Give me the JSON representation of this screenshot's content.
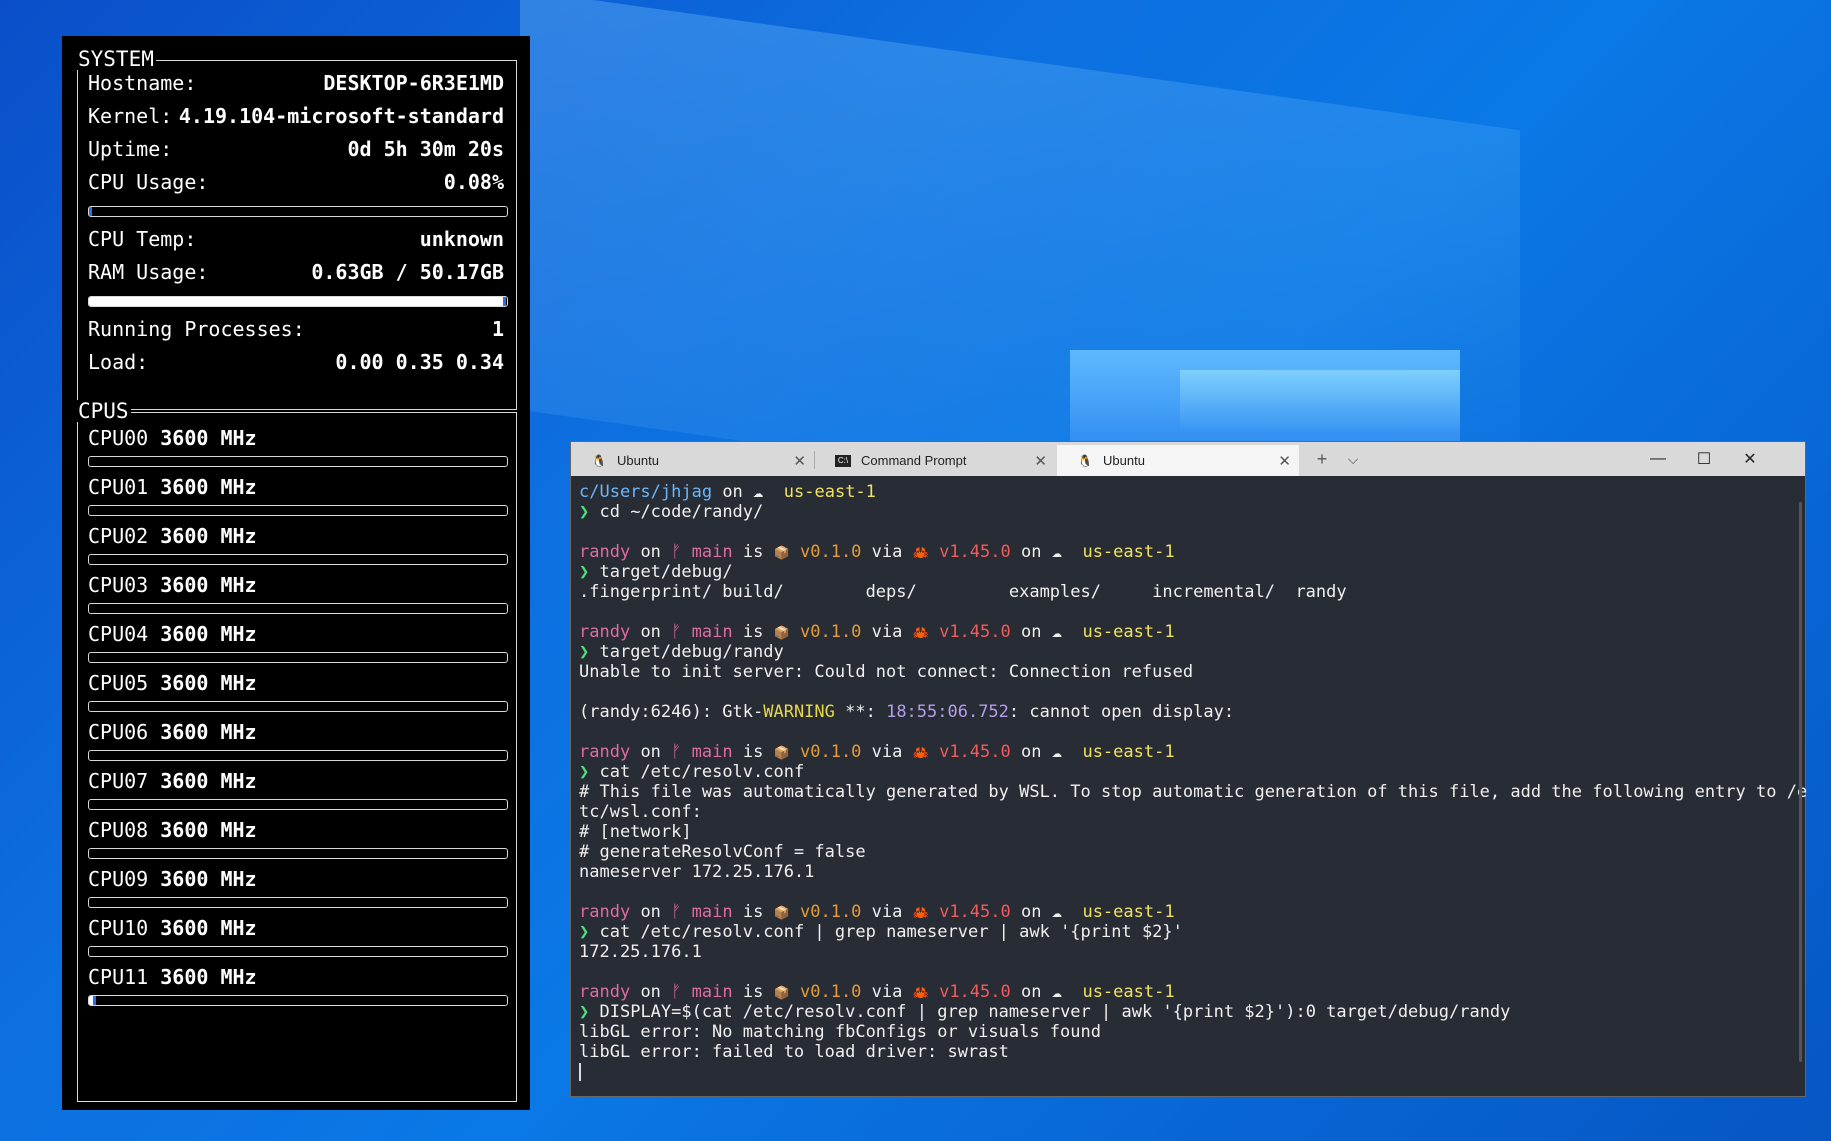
{
  "colors": {
    "accent": "#2a6ef0",
    "terminal_bg": "#282c34",
    "desktop": "#0a6fe0"
  },
  "system": {
    "title": "SYSTEM",
    "rows": [
      {
        "label": "Hostname:",
        "value": "DESKTOP-6R3E1MD"
      },
      {
        "label": "Kernel:",
        "value": "4.19.104-microsoft-standard"
      },
      {
        "label": "Uptime:",
        "value": "0d 5h 30m 20s"
      },
      {
        "label": "CPU Usage:",
        "value": "0.08%"
      },
      {
        "label": "CPU Temp:",
        "value": "unknown"
      },
      {
        "label": "RAM Usage:",
        "value": "0.63GB / 50.17GB"
      },
      {
        "label": "Running Processes:",
        "value": "1"
      },
      {
        "label": "Load:",
        "value": "0.00 0.35 0.34"
      }
    ],
    "cpu_usage_fraction": 0.0008,
    "ram_usage_fraction": 0.99
  },
  "cpus": {
    "title": "CPUS",
    "items": [
      {
        "name": "CPU00",
        "freq": "3600 MHz",
        "usage": 0.0
      },
      {
        "name": "CPU01",
        "freq": "3600 MHz",
        "usage": 0.0
      },
      {
        "name": "CPU02",
        "freq": "3600 MHz",
        "usage": 0.0
      },
      {
        "name": "CPU03",
        "freq": "3600 MHz",
        "usage": 0.0
      },
      {
        "name": "CPU04",
        "freq": "3600 MHz",
        "usage": 0.0
      },
      {
        "name": "CPU05",
        "freq": "3600 MHz",
        "usage": 0.0
      },
      {
        "name": "CPU06",
        "freq": "3600 MHz",
        "usage": 0.0
      },
      {
        "name": "CPU07",
        "freq": "3600 MHz",
        "usage": 0.0
      },
      {
        "name": "CPU08",
        "freq": "3600 MHz",
        "usage": 0.0
      },
      {
        "name": "CPU09",
        "freq": "3600 MHz",
        "usage": 0.0
      },
      {
        "name": "CPU10",
        "freq": "3600 MHz",
        "usage": 0.0
      },
      {
        "name": "CPU11",
        "freq": "3600 MHz",
        "usage": 0.01
      }
    ]
  },
  "terminal": {
    "tabs": [
      {
        "label": "Ubuntu",
        "icon": "linux-penguin-icon",
        "active": false
      },
      {
        "label": "Command Prompt",
        "icon": "cmd-icon",
        "active": false
      },
      {
        "label": "Ubuntu",
        "icon": "linux-penguin-icon",
        "active": true
      }
    ],
    "new_tab": "+",
    "dropdown": "⌵",
    "minimize": "—",
    "maximize": "☐",
    "close": "✕",
    "prompt": {
      "user": "randy",
      "on": "on",
      "branch_icon": "ᚠ",
      "branch": "main",
      "is": "is",
      "pkg_icon": "📦",
      "version": "v0.1.0",
      "via": "via",
      "rust_icon": "🦀",
      "rust_version": "v1.45.0",
      "cloud_icon": "☁",
      "region": "us-east-1",
      "arrow": "❯"
    },
    "first_prompt": {
      "path": "c/Users/jhjag",
      "on": "on",
      "cloud_icon": "☁",
      "region": "us-east-1"
    },
    "commands": {
      "c1": "cd ~/code/randy/",
      "c2": "target/debug/",
      "c3": "target/debug/randy",
      "c4": "cat /etc/resolv.conf",
      "c5": "cat /etc/resolv.conf | grep nameserver | awk '{print $2}'",
      "c6": "DISPLAY=$(cat /etc/resolv.conf | grep nameserver | awk '{print $2}'):0 target/debug/randy"
    },
    "output": {
      "ls": ".fingerprint/ build/        deps/         examples/     incremental/  randy",
      "err1": "Unable to init server: Could not connect: Connection refused",
      "gtk_pre": "(randy:6246): Gtk-",
      "gtk_warn": "WARNING",
      "gtk_mid": " **: ",
      "gtk_time": "18:55:06.752",
      "gtk_post": ": cannot open display:",
      "r1": "# This file was automatically generated by WSL. To stop automatic generation of this file, add the following entry to /e",
      "r2": "tc/wsl.conf:",
      "r3": "# [network]",
      "r4": "# generateResolvConf = false",
      "r5": "nameserver 172.25.176.1",
      "ip": "172.25.176.1",
      "gl1": "libGL error: No matching fbConfigs or visuals found",
      "gl2": "libGL error: failed to load driver: swrast"
    }
  }
}
